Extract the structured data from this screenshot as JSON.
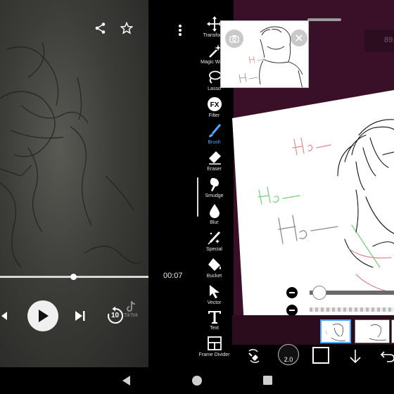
{
  "video": {
    "elapsed": "00:07",
    "progress_fraction": 0.45,
    "watermark": "TikTok",
    "icons": [
      "share-icon",
      "star-icon",
      "trash-icon",
      "more-vert-icon",
      "previous-icon",
      "play-icon",
      "skip-next-icon",
      "replay-10-icon"
    ],
    "replay_label": "10"
  },
  "drawing_app": {
    "zoom": "89.3%",
    "tools": [
      {
        "key": "transform",
        "label": "Transform",
        "icon": "move-icon",
        "active": false
      },
      {
        "key": "magic-wand",
        "label": "Magic Wand",
        "icon": "magic-wand-icon",
        "active": false
      },
      {
        "key": "lasso",
        "label": "Lasso",
        "icon": "lasso-icon",
        "active": false
      },
      {
        "key": "filter",
        "label": "Filter",
        "icon": "fx-icon",
        "active": false
      },
      {
        "key": "brush",
        "label": "Brush",
        "icon": "brush-icon",
        "active": true
      },
      {
        "key": "eraser",
        "label": "Eraser",
        "icon": "eraser-icon",
        "active": false
      },
      {
        "key": "smudge",
        "label": "Smudge",
        "icon": "smudge-icon",
        "active": false
      },
      {
        "key": "blur",
        "label": "Blur",
        "icon": "drop-icon",
        "active": false
      },
      {
        "key": "special",
        "label": "Special",
        "icon": "special-pen-icon",
        "active": false
      },
      {
        "key": "bucket",
        "label": "Bucket",
        "icon": "bucket-icon",
        "active": false
      },
      {
        "key": "vector",
        "label": "Vector",
        "icon": "cursor-icon",
        "active": false
      },
      {
        "key": "text",
        "label": "Text",
        "icon": "text-icon",
        "active": false
      },
      {
        "key": "frame-divider",
        "label": "Frame Divider",
        "icon": "frame-divider-icon",
        "active": false
      }
    ],
    "brush_size": "2.0",
    "brush_opacity": "100",
    "bottom_brush_size": "2.0",
    "current_color": "#000000",
    "accent_color": "#4aa8ff"
  }
}
